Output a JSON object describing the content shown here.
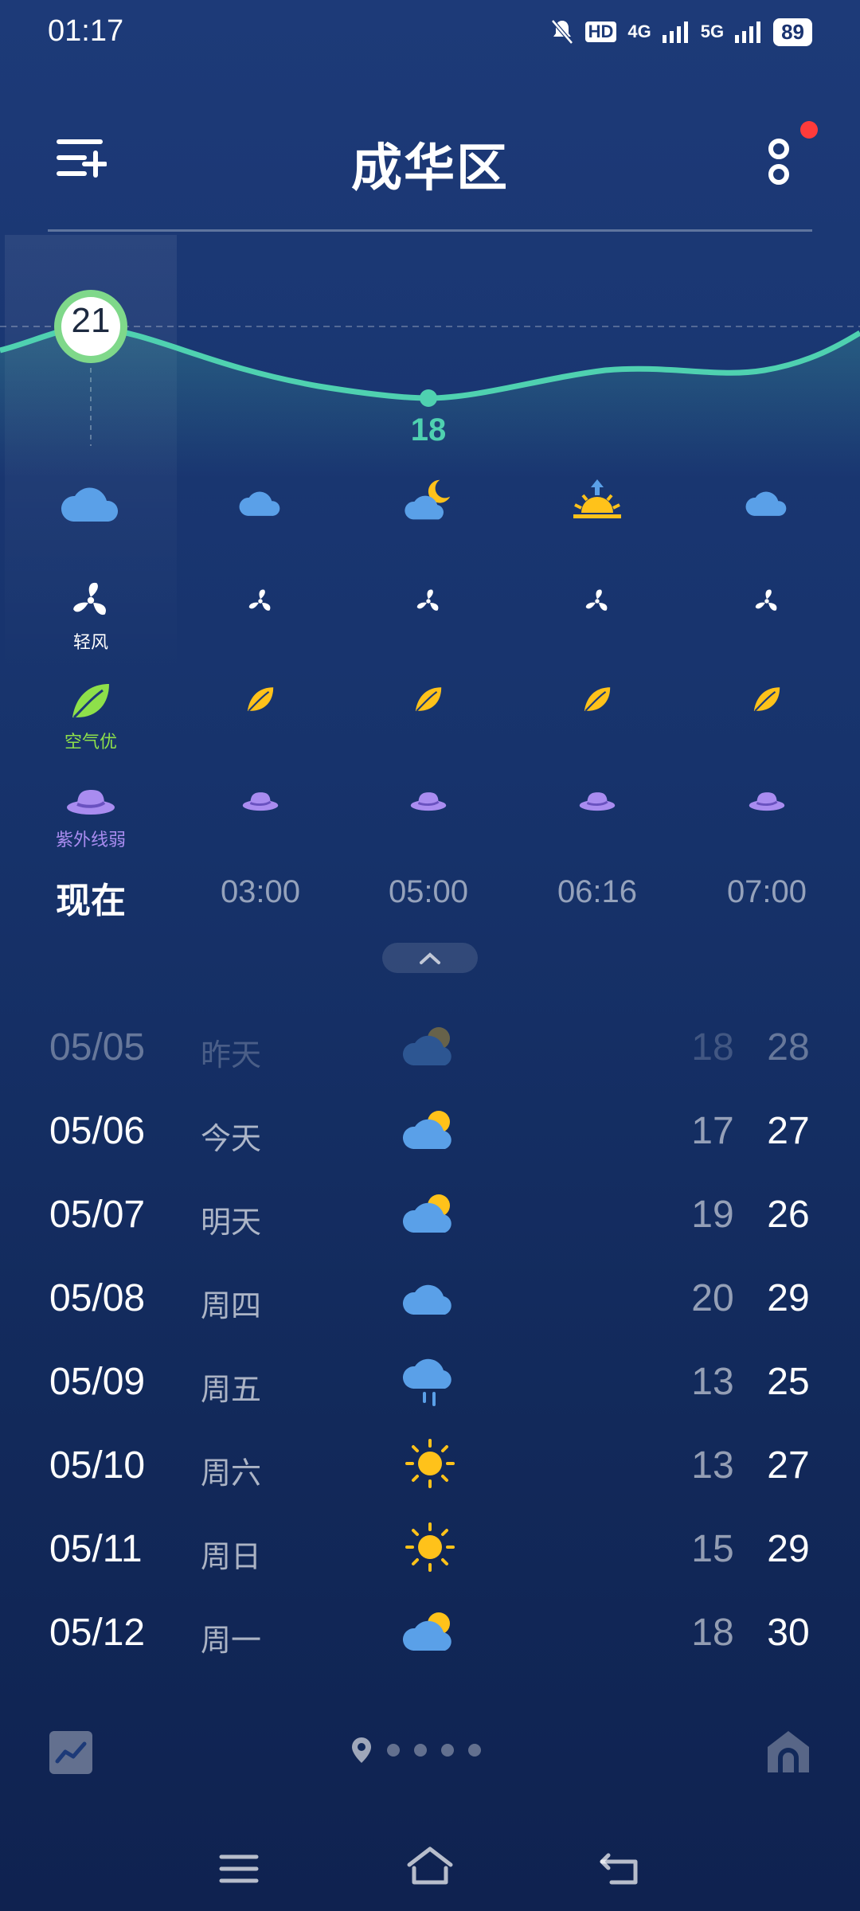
{
  "status_bar": {
    "time": "01:17",
    "hd": "HD",
    "network1": "4G",
    "network2": "5G",
    "battery": "89"
  },
  "header": {
    "title": "成华区"
  },
  "hourly": {
    "current_temp": "21",
    "min_temp": "18",
    "wind_label": "轻风",
    "air_label": "空气优",
    "uv_label": "紫外线弱",
    "hours": [
      "现在",
      "03:00",
      "05:00",
      "06:16",
      "07:00"
    ],
    "icons": [
      "cloud-icon",
      "cloud-icon",
      "cloud-moon-icon",
      "sunrise-icon",
      "cloud-icon"
    ]
  },
  "daily": [
    {
      "date": "05/05",
      "day": "昨天",
      "icon": "partly-cloudy-icon",
      "low": "18",
      "high": "28"
    },
    {
      "date": "05/06",
      "day": "今天",
      "icon": "partly-cloudy-icon",
      "low": "17",
      "high": "27"
    },
    {
      "date": "05/07",
      "day": "明天",
      "icon": "partly-cloudy-icon",
      "low": "19",
      "high": "26"
    },
    {
      "date": "05/08",
      "day": "周四",
      "icon": "cloud-icon",
      "low": "20",
      "high": "29"
    },
    {
      "date": "05/09",
      "day": "周五",
      "icon": "rain-icon",
      "low": "13",
      "high": "25"
    },
    {
      "date": "05/10",
      "day": "周六",
      "icon": "sun-icon",
      "low": "13",
      "high": "27"
    },
    {
      "date": "05/11",
      "day": "周日",
      "icon": "sun-icon",
      "low": "15",
      "high": "29"
    },
    {
      "date": "05/12",
      "day": "周一",
      "icon": "partly-cloudy-icon",
      "low": "18",
      "high": "30"
    }
  ],
  "colors": {
    "accent_green": "#7fd88a",
    "curve": "#4fd1b0",
    "sun": "#ffc21a",
    "uv": "#a98cf0",
    "air": "#8ee04a"
  }
}
